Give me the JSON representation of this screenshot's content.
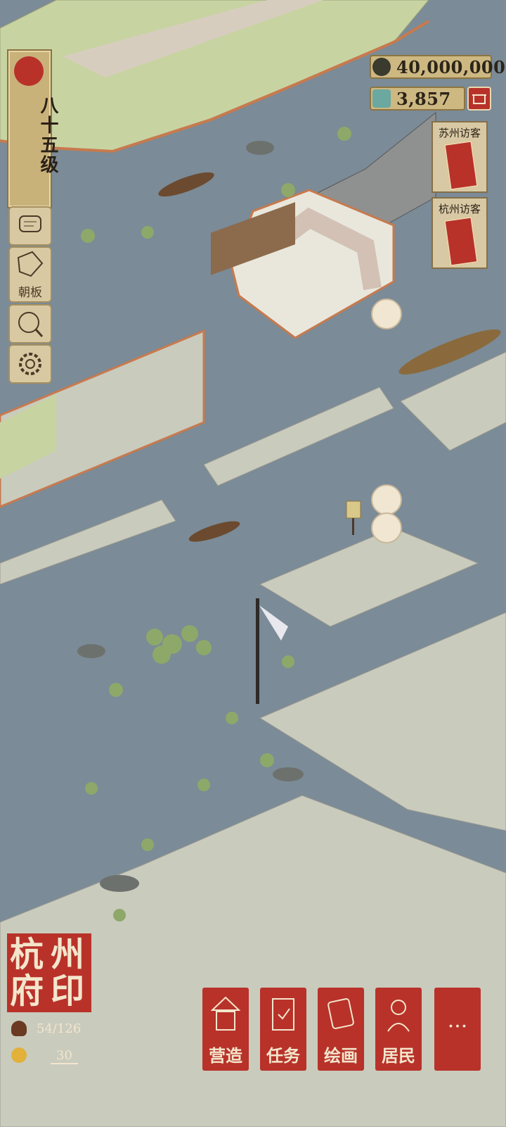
{
  "level": {
    "label": "八十五级"
  },
  "side_buttons": [
    {
      "name": "chat",
      "label": ""
    },
    {
      "name": "board",
      "label": "朝板"
    },
    {
      "name": "shop-search",
      "label": ""
    },
    {
      "name": "settings",
      "label": ""
    }
  ],
  "currency": {
    "coins": "40,000,000",
    "gems": "3,857"
  },
  "visitors": [
    {
      "label": "苏州访客"
    },
    {
      "label": "杭州访客"
    }
  ],
  "city_seal": {
    "chars": [
      "杭",
      "州",
      "府",
      "印"
    ],
    "population": "54/126",
    "happiness": "30"
  },
  "menu": [
    {
      "label": "营造"
    },
    {
      "label": "任务"
    },
    {
      "label": "绘画"
    },
    {
      "label": "居民"
    },
    {
      "label": "···"
    }
  ],
  "colors": {
    "water": "#7b8b97",
    "tile": "#c9cbbd",
    "grass": "#c8d3a2",
    "seal_red": "#b8322a",
    "parchment": "#d8c9a4"
  }
}
